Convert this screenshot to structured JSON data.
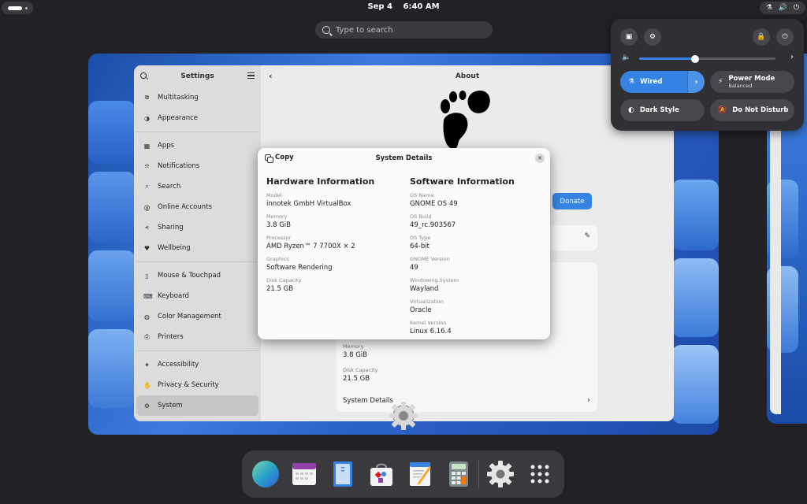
{
  "topbar": {
    "date": "Sep 4",
    "time": "6:40 AM"
  },
  "search": {
    "placeholder": "Type to search"
  },
  "settings": {
    "sidebar_title": "Settings",
    "content_title": "About",
    "sidebar_groups": [
      [
        {
          "label": "Multitasking",
          "icon": "multitasking-icon"
        },
        {
          "label": "Appearance",
          "icon": "appearance-icon"
        }
      ],
      [
        {
          "label": "Apps",
          "icon": "apps-icon"
        },
        {
          "label": "Notifications",
          "icon": "bell-icon"
        },
        {
          "label": "Search",
          "icon": "search-icon"
        },
        {
          "label": "Online Accounts",
          "icon": "at-icon"
        },
        {
          "label": "Sharing",
          "icon": "share-icon"
        },
        {
          "label": "Wellbeing",
          "icon": "wellbeing-icon"
        }
      ],
      [
        {
          "label": "Mouse & Touchpad",
          "icon": "mouse-icon"
        },
        {
          "label": "Keyboard",
          "icon": "keyboard-icon"
        },
        {
          "label": "Color Management",
          "icon": "palette-icon"
        },
        {
          "label": "Printers",
          "icon": "printer-icon"
        }
      ],
      [
        {
          "label": "Accessibility",
          "icon": "accessibility-icon"
        },
        {
          "label": "Privacy & Security",
          "icon": "hand-icon"
        },
        {
          "label": "System",
          "icon": "gear-icon",
          "active": true
        }
      ]
    ],
    "donate_label": "Donate",
    "behind_card": {
      "memory_label": "Memory",
      "memory_value": "3.8 GiB",
      "disk_label": "Disk Capacity",
      "disk_value": "21.5 GB",
      "system_details_label": "System Details"
    }
  },
  "dialog": {
    "title": "System Details",
    "copy_label": "Copy",
    "hardware": {
      "heading": "Hardware Information",
      "fields": [
        {
          "label": "Model",
          "value": "innotek GmbH VirtualBox"
        },
        {
          "label": "Memory",
          "value": "3.8 GiB"
        },
        {
          "label": "Processor",
          "value": "AMD Ryzen™ 7 7700X × 2"
        },
        {
          "label": "Graphics",
          "value": "Software Rendering"
        },
        {
          "label": "Disk Capacity",
          "value": "21.5 GB"
        }
      ]
    },
    "software": {
      "heading": "Software Information",
      "fields": [
        {
          "label": "OS Name",
          "value": "GNOME OS 49"
        },
        {
          "label": "OS Build",
          "value": "49_rc.903567"
        },
        {
          "label": "OS Type",
          "value": "64-bit"
        },
        {
          "label": "GNOME Version",
          "value": "49"
        },
        {
          "label": "Windowing System",
          "value": "Wayland"
        },
        {
          "label": "Virtualization",
          "value": "Oracle"
        },
        {
          "label": "Kernel Version",
          "value": "Linux 6.16.4"
        }
      ]
    }
  },
  "quick_settings": {
    "volume_percent": 41,
    "tiles": {
      "wired": "Wired",
      "power_mode": "Power Mode",
      "power_mode_sub": "Balanced",
      "dark_style": "Dark Style",
      "dnd": "Do Not Disturb"
    }
  },
  "dock": {
    "apps": [
      "web-browser-icon",
      "calendar-icon",
      "files-icon",
      "software-icon",
      "text-editor-icon",
      "calculator-icon",
      "settings-icon",
      "show-apps-icon"
    ]
  },
  "colors": {
    "accent": "#3584e4",
    "panel": "#303034",
    "background": "#222226"
  }
}
